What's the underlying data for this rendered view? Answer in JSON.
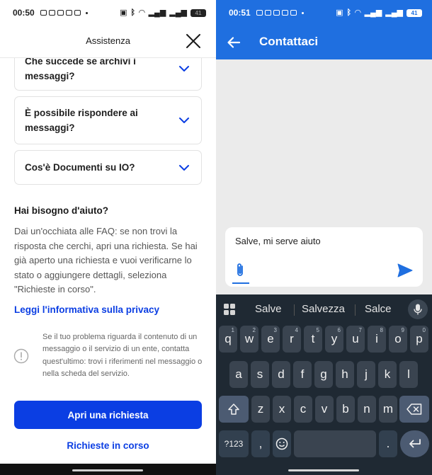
{
  "left": {
    "status": {
      "time": "00:50"
    },
    "header": {
      "title": "Assistenza"
    },
    "faq": [
      {
        "question": "Che succede se archivi i messaggi?"
      },
      {
        "question": "È possibile rispondere ai messaggi?"
      },
      {
        "question": "Cos'è Documenti su IO?"
      }
    ],
    "help": {
      "title": "Hai bisogno d'aiuto?",
      "body": "Dai un'occhiata alle FAQ: se non trovi la risposta che cerchi, apri una richiesta. Se hai già aperto una richiesta e vuoi verificarne lo stato o aggiungere dettagli, seleziona \"Richieste in corso\".",
      "privacy_link": "Leggi l'informativa sulla privacy"
    },
    "info": {
      "text": "Se il tuo problema riguarda il contenuto di un messaggio o il servizio di un ente, contatta quest'ultimo: trovi i riferimenti nel messaggio o nella scheda del servizio."
    },
    "actions": {
      "primary": "Apri una richiesta",
      "secondary": "Richieste in corso"
    }
  },
  "right": {
    "status": {
      "time": "00:51"
    },
    "appbar": {
      "title": "Contattaci"
    },
    "compose": {
      "text": "Salve, mi serve aiuto"
    },
    "keyboard": {
      "suggestions": [
        "Salve",
        "Salvezza",
        "Salce"
      ],
      "row1": [
        {
          "k": "q",
          "n": "1"
        },
        {
          "k": "w",
          "n": "2"
        },
        {
          "k": "e",
          "n": "3"
        },
        {
          "k": "r",
          "n": "4"
        },
        {
          "k": "t",
          "n": "5"
        },
        {
          "k": "y",
          "n": "6"
        },
        {
          "k": "u",
          "n": "7"
        },
        {
          "k": "i",
          "n": "8"
        },
        {
          "k": "o",
          "n": "9"
        },
        {
          "k": "p",
          "n": "0"
        }
      ],
      "row2": [
        "a",
        "s",
        "d",
        "f",
        "g",
        "h",
        "j",
        "k",
        "l"
      ],
      "row3": [
        "z",
        "x",
        "c",
        "v",
        "b",
        "n",
        "m"
      ],
      "symbols_key": "?123",
      "comma_key": ",",
      "period_key": "."
    }
  },
  "colors": {
    "primary_blue": "#0b3ee3",
    "appbar_blue": "#1f6fe0",
    "keyboard_bg": "#1f2933"
  }
}
